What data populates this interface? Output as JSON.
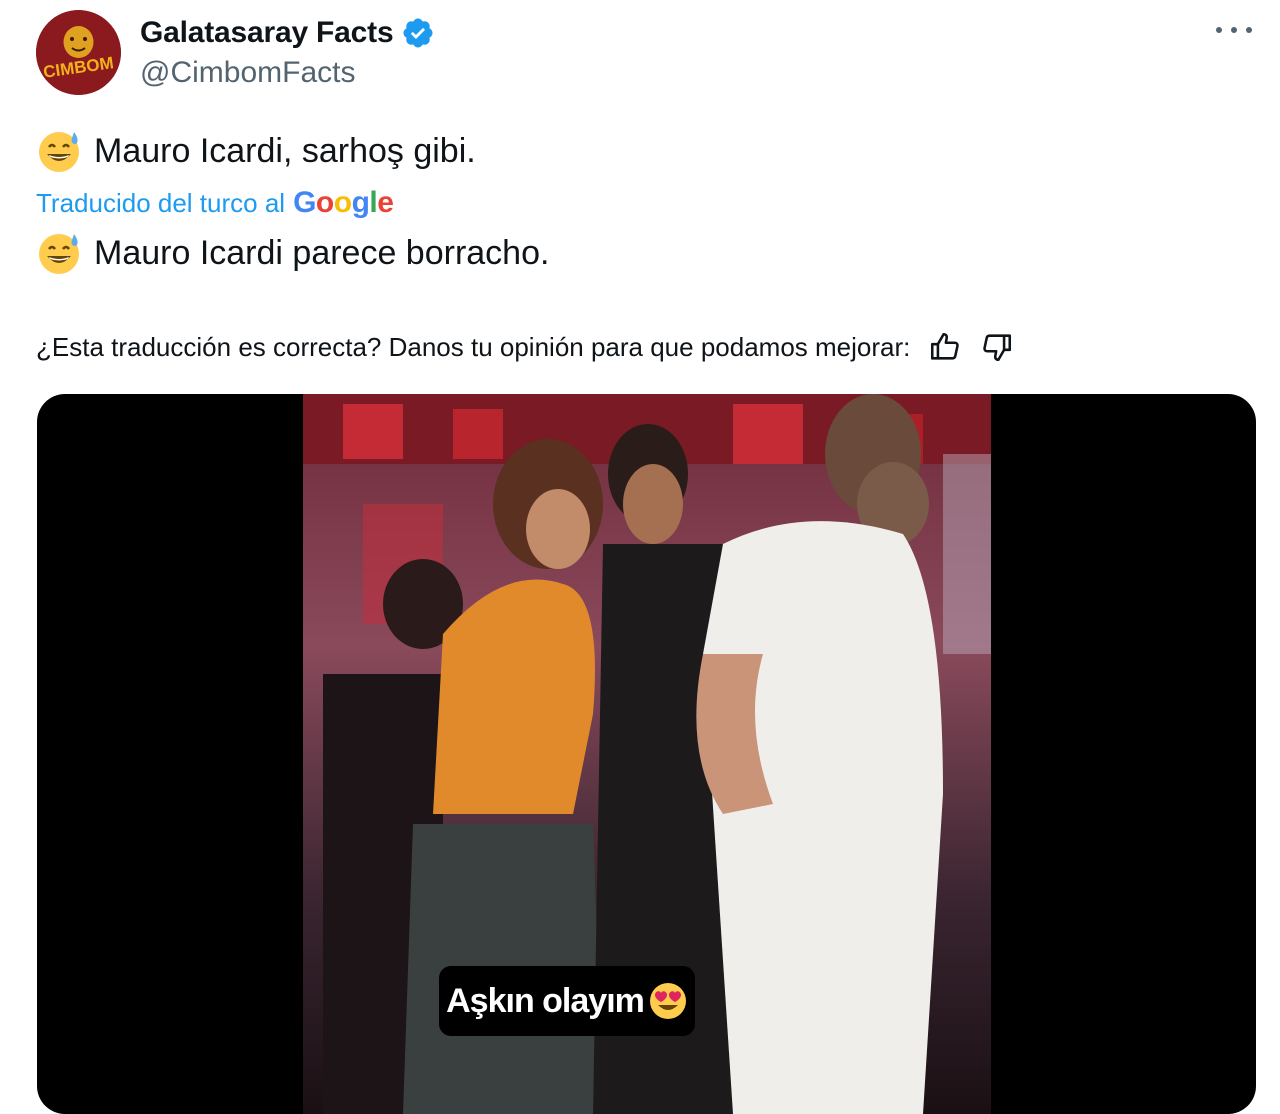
{
  "author": {
    "display_name": "Galatasaray Facts",
    "handle": "@CimbomFacts",
    "avatar_text": "CIMBOM",
    "verified": true
  },
  "tweet": {
    "original_text": "Mauro Icardi, sarhoş gibi.",
    "translated_label": "Traducido del turco al",
    "translator": "Google",
    "translated_text": "Mauro Icardi parece borracho.",
    "emoji": "grinning-face-with-sweat-icon"
  },
  "feedback": {
    "question": "¿Esta traducción es correcta? Danos tu opinión para que podamos mejorar:",
    "thumbs_up_icon": "thumbs-up-icon",
    "thumbs_down_icon": "thumbs-down-icon"
  },
  "media": {
    "video_caption": "Aşkın olayım",
    "caption_emoji": "heart-eyes-emoji-icon"
  },
  "colors": {
    "accent": "#1d9bf0",
    "secondary_text": "#536471",
    "avatar_bg": "#8b1a1e",
    "google_blue": "#4285F4",
    "google_red": "#EA4335",
    "google_yellow": "#FBBC05",
    "google_green": "#34A853"
  }
}
